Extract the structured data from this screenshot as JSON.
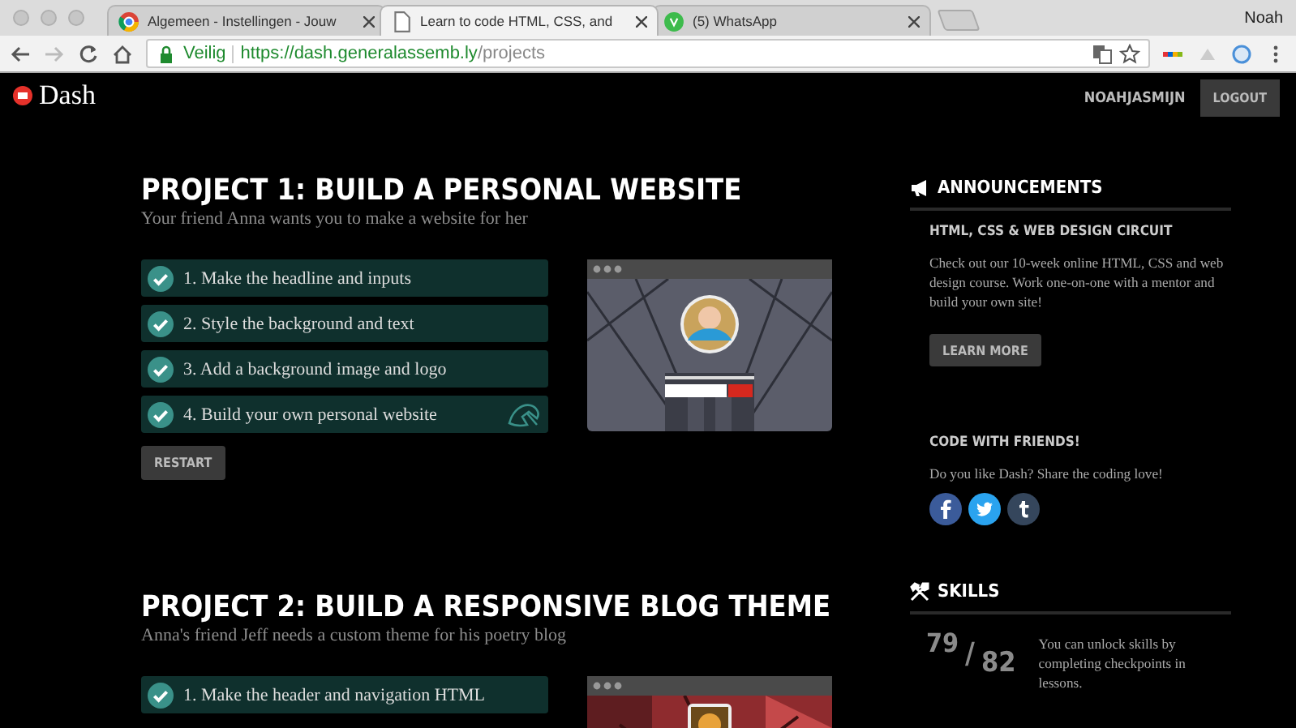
{
  "browser": {
    "tabs": [
      {
        "title": "Algemeen - Instellingen - Jouw",
        "kind": "chrome",
        "selected": false
      },
      {
        "title": "Learn to code HTML, CSS, and",
        "kind": "page",
        "selected": true
      },
      {
        "title": "(5) WhatsApp",
        "kind": "whatsapp",
        "selected": false
      }
    ],
    "profile": "Noah",
    "address": {
      "security": "Veilig",
      "host": "https://dash.generalassemb.ly",
      "path": "/projects"
    }
  },
  "header": {
    "logo": "Dash",
    "username": "NOAHJASMIJN",
    "logout": "LOGOUT"
  },
  "projects": [
    {
      "title": "PROJECT 1: BUILD A PERSONAL WEBSITE",
      "subtitle": "Your friend Anna wants you to make a website for her",
      "steps": [
        {
          "label": "1. Make the headline and inputs",
          "kind": "step",
          "done": true
        },
        {
          "label": "2. Style the background and text",
          "kind": "step",
          "done": true
        },
        {
          "label": "3. Add a background image and logo",
          "kind": "step",
          "done": true
        },
        {
          "label": "4. Build your own personal website",
          "kind": "final",
          "done": true
        }
      ],
      "restart": "RESTART",
      "preview": {
        "kind": "picture"
      }
    },
    {
      "title": "PROJECT 2: BUILD A RESPONSIVE BLOG THEME",
      "subtitle": "Anna's friend Jeff needs a custom theme for his poetry blog",
      "steps": [
        {
          "label": "1. Make the header and navigation HTML",
          "kind": "step",
          "done": true
        }
      ],
      "preview": {
        "kind": "picture"
      }
    }
  ],
  "sidebar": {
    "announcements": {
      "heading": "ANNOUNCEMENTS",
      "title": "HTML, CSS & WEB DESIGN CIRCUIT",
      "text": "Check out our 10-week online HTML, CSS and web design course. Work one-on-one with a mentor and build your own site!",
      "button": "LEARN MORE"
    },
    "friends": {
      "heading": "CODE WITH FRIENDS!",
      "text": "Do you like Dash? Share the coding love!",
      "shares": [
        {
          "kind": "facebook"
        },
        {
          "kind": "twitter"
        },
        {
          "kind": "tumblr"
        }
      ]
    },
    "skills": {
      "heading": "SKILLS",
      "earned": "79",
      "separator": "/",
      "total": "82",
      "text": "You can unlock skills by completing checkpoints in lessons."
    }
  }
}
